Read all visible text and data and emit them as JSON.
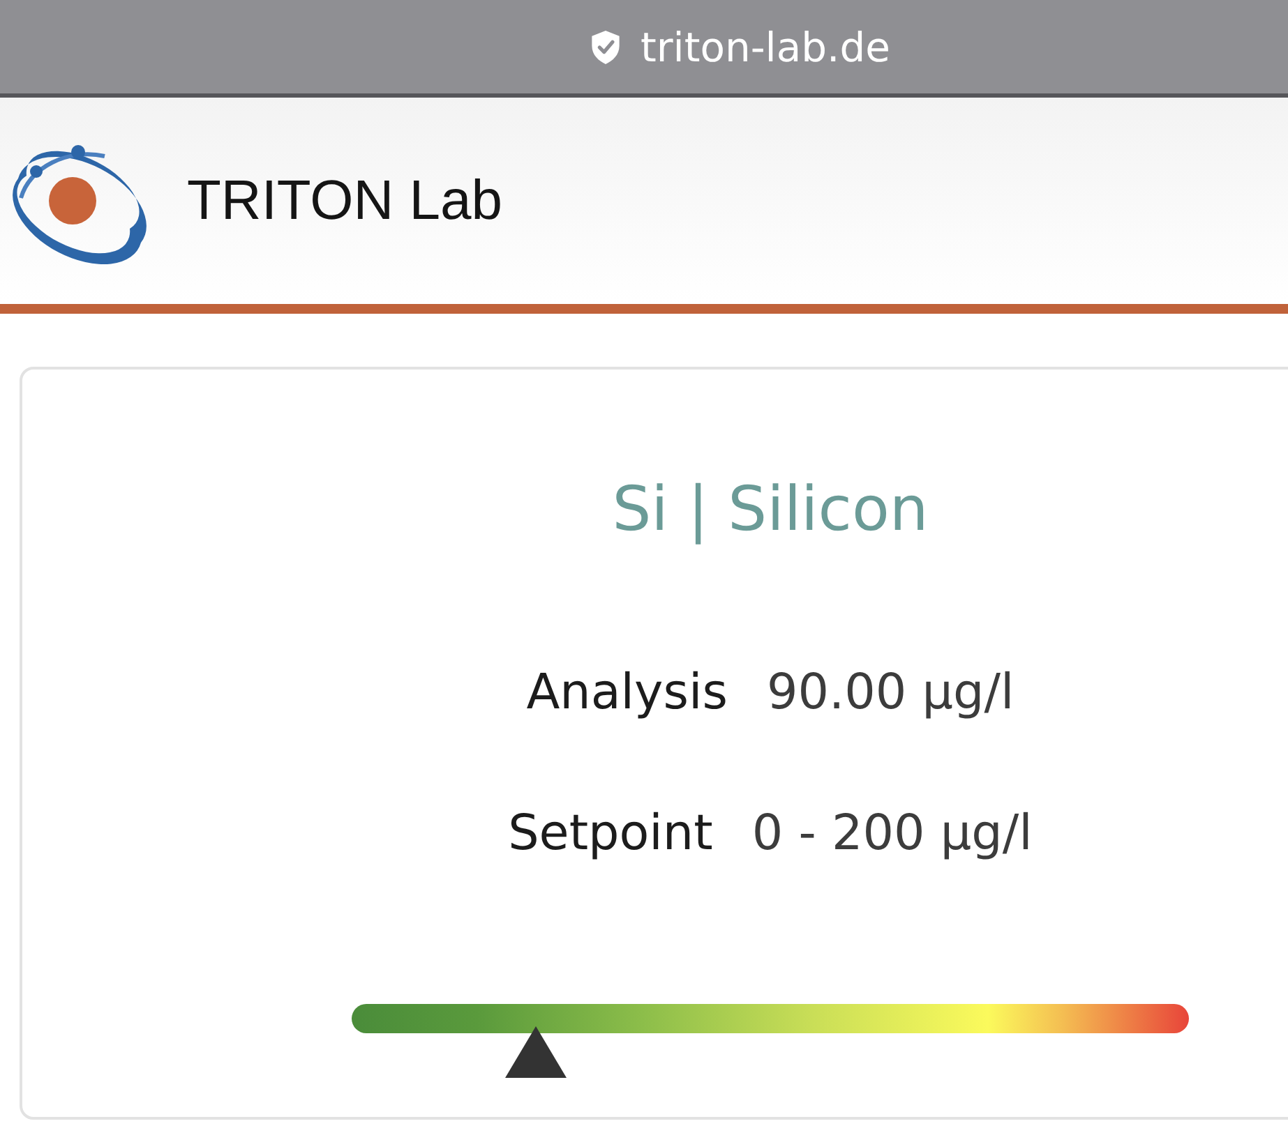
{
  "browser": {
    "url": "triton-lab.de"
  },
  "header": {
    "brand": "TRITON Lab"
  },
  "card": {
    "title": "Si | Silicon",
    "readings": [
      {
        "label": "Analysis",
        "value": "90.00 µg/l"
      },
      {
        "label": "Setpoint",
        "value": "0 - 200 µg/l"
      }
    ],
    "gauge": {
      "level": 0.22
    }
  }
}
